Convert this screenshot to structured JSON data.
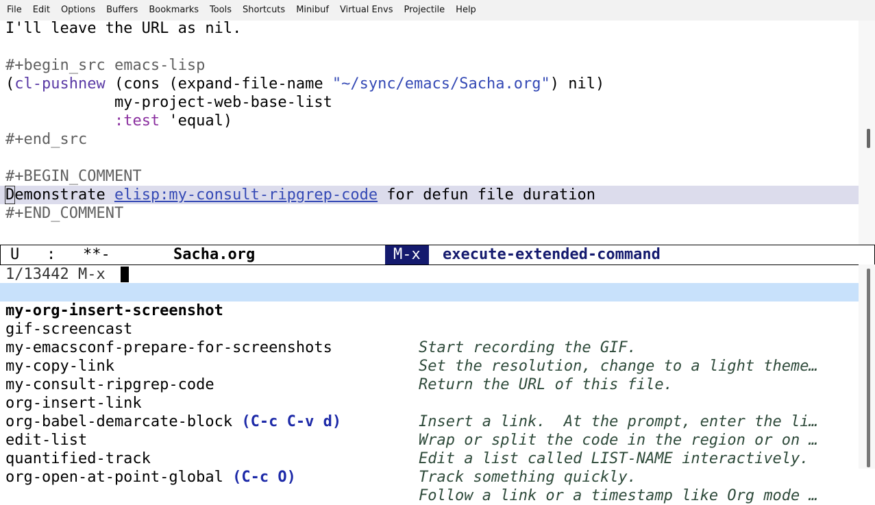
{
  "menu": [
    "File",
    "Edit",
    "Options",
    "Buffers",
    "Bookmarks",
    "Tools",
    "Shortcuts",
    "Minibuf",
    "Virtual Envs",
    "Projectile",
    "Help"
  ],
  "buffer": {
    "line1": "I'll leave the URL as nil.",
    "begin_src": "#+begin_src",
    "lang": " emacs-lisp",
    "code1_open": "(",
    "code1_fn": "cl-pushnew",
    "code1_mid": " (cons (expand-file-name ",
    "code1_str": "\"~/sync/emacs/Sacha.org\"",
    "code1_end": ") nil)",
    "code2": "            my-project-web-base-list",
    "code3_indent": "            ",
    "code3_kw": ":test",
    "code3_rest": " 'equal)",
    "end_src": "#+end_src",
    "begin_comment": "#+BEGIN_COMMENT",
    "comment_first_char": "D",
    "comment_pre": "emonstrate ",
    "comment_link": "elisp:my-consult-ripgrep-code",
    "comment_post": " for defun file duration",
    "end_comment": "#+END_COMMENT"
  },
  "modeline": {
    "status": "U   :   **-",
    "buffer_name": "Sacha.org",
    "key": "M-x",
    "command": "execute-extended-command"
  },
  "minibuffer": {
    "prompt": "1/13442 M-x "
  },
  "candidates": [
    {
      "name": "my-org-insert-screenshot",
      "key": "",
      "doc": ""
    },
    {
      "name": "gif-screencast",
      "key": "",
      "doc": "Start recording the GIF."
    },
    {
      "name": "my-emacsconf-prepare-for-screenshots",
      "key": "",
      "doc": "Set the resolution, change to a light theme…"
    },
    {
      "name": "my-copy-link",
      "key": "",
      "doc": "Return the URL of this file."
    },
    {
      "name": "my-consult-ripgrep-code",
      "key": "",
      "doc": ""
    },
    {
      "name": "org-insert-link",
      "key": "",
      "doc": "Insert a link.  At the prompt, enter the li…"
    },
    {
      "name": "org-babel-demarcate-block",
      "key": "(C-c C-v d)",
      "doc": "Wrap or split the code in the region or on …"
    },
    {
      "name": "edit-list",
      "key": "",
      "doc": "Edit a list called LIST-NAME interactively."
    },
    {
      "name": "quantified-track",
      "key": "",
      "doc": "Track something quickly."
    },
    {
      "name": "org-open-at-point-global",
      "key": "(C-c O)",
      "doc": "Follow a link or a timestamp like Org mode …"
    }
  ]
}
